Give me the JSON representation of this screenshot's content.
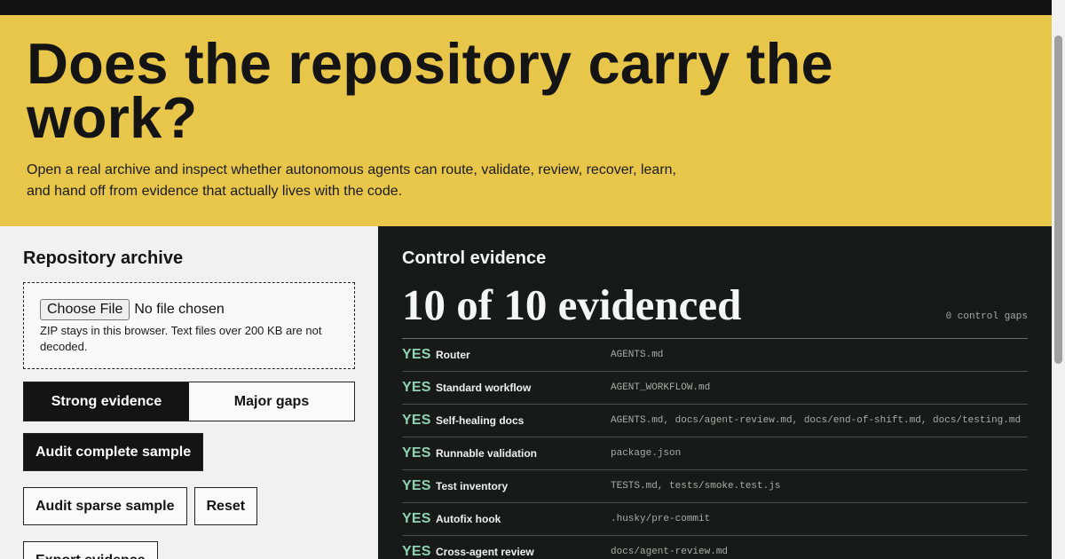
{
  "hero": {
    "title": "Does the repository carry the work?",
    "subtitle": "Open a real archive and inspect whether autonomous agents can route, validate, review, recover, learn, and hand off from evidence that actually lives with the code."
  },
  "archive": {
    "heading": "Repository archive",
    "file_button": "Choose File",
    "file_status": "No file chosen",
    "hint": "ZIP stays in this browser. Text files over 200 KB are not decoded.",
    "segments": [
      {
        "label": "Strong evidence",
        "active": true
      },
      {
        "label": "Major gaps",
        "active": false
      }
    ],
    "buttons": {
      "audit_complete": "Audit complete sample",
      "audit_sparse": "Audit sparse sample",
      "reset": "Reset",
      "export": "Export evidence"
    }
  },
  "evidence": {
    "heading": "Control evidence",
    "summary": "10 of 10 evidenced",
    "gaps": "0 control gaps",
    "rows": [
      {
        "status": "YES",
        "name": "Router",
        "files": "AGENTS.md"
      },
      {
        "status": "YES",
        "name": "Standard workflow",
        "files": "AGENT_WORKFLOW.md"
      },
      {
        "status": "YES",
        "name": "Self-healing docs",
        "files": "AGENTS.md, docs/agent-review.md, docs/end-of-shift.md, docs/testing.md"
      },
      {
        "status": "YES",
        "name": "Runnable validation",
        "files": "package.json"
      },
      {
        "status": "YES",
        "name": "Test inventory",
        "files": "TESTS.md, tests/smoke.test.js"
      },
      {
        "status": "YES",
        "name": "Autofix hook",
        "files": ".husky/pre-commit"
      },
      {
        "status": "YES",
        "name": "Cross-agent review",
        "files": "docs/agent-review.md"
      }
    ]
  },
  "colors": {
    "hero_bg": "#e8c64a",
    "panel_dark": "#171a18",
    "yes_green": "#8fd3b3"
  }
}
